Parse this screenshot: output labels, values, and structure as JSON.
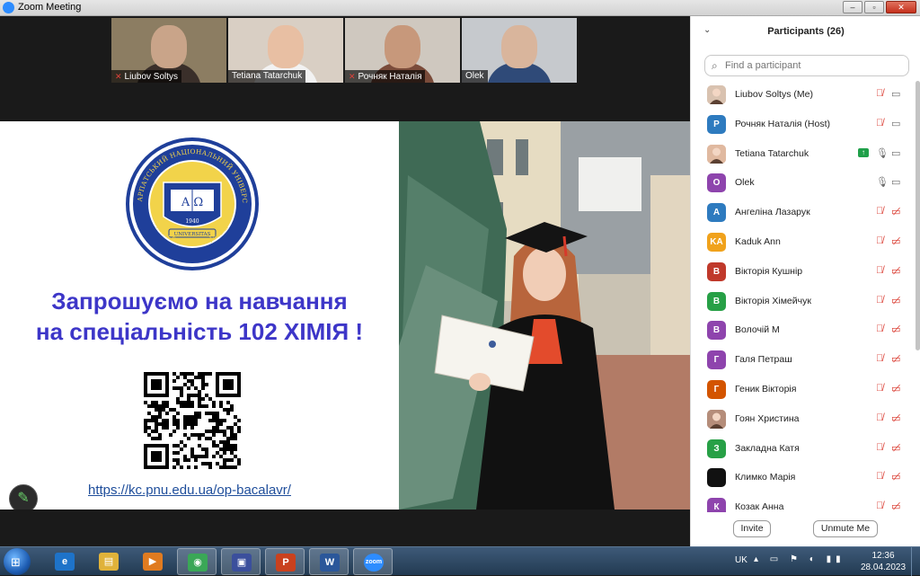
{
  "window": {
    "title": "Zoom Meeting",
    "controls": [
      "–",
      "▫",
      "✕"
    ]
  },
  "videos": [
    {
      "name": "Liubov Soltys",
      "muted": true,
      "bg": "#8c7d62",
      "face": "#c9a489",
      "body": "#3a2f2a"
    },
    {
      "name": "Tetiana Tatarchuk",
      "muted": false,
      "bg": "#d9cfc4",
      "face": "#e8bfa3",
      "body": "#f2f2f2"
    },
    {
      "name": "Рочняк Наталія",
      "muted": true,
      "bg": "#cfc8bf",
      "face": "#c7987b",
      "body": "#7a4b3a"
    },
    {
      "name": "Olek",
      "muted": false,
      "bg": "#c6c9cd",
      "face": "#d9b59c",
      "body": "#2f4a78"
    }
  ],
  "slide": {
    "headline_line1": "Запрошуємо на навчання",
    "headline_line2": "на спеціальність 102 ХІМІЯ !",
    "url": "https://kc.pnu.edu.ua/op-bacalavr/",
    "logo": {
      "ring_text": "ПРИКАРПАТСЬКИЙ НАЦІОНАЛЬНИЙ УНІВЕРСИТЕТ",
      "bottom_text": "імені Василя Стефаника",
      "book_text": "Α Ω",
      "year": "1940",
      "banner": "UNIVERSITAS"
    },
    "pen_icon": "pen-icon"
  },
  "participants": {
    "title": "Participants (26)",
    "search_placeholder": "Find a participant",
    "list": [
      {
        "name": "Liubov Soltys (Me)",
        "initials": "",
        "color": "#d9c2b0",
        "photo": true,
        "mic": "muted",
        "cam": "on",
        "share": false
      },
      {
        "name": "Рочняк Наталія (Host)",
        "initials": "Р",
        "color": "#2e7bbf",
        "photo": false,
        "mic": "muted",
        "cam": "on",
        "share": false
      },
      {
        "name": "Tetiana Tatarchuk",
        "initials": "",
        "color": "#e0b9a0",
        "photo": true,
        "mic": "on",
        "cam": "on",
        "share": true
      },
      {
        "name": "Olek",
        "initials": "O",
        "color": "#8e44ad",
        "photo": false,
        "mic": "on",
        "cam": "on",
        "share": false
      },
      {
        "name": " Ангеліна Лазарук",
        "initials": "А",
        "color": "#2e7bbf",
        "photo": false,
        "mic": "muted",
        "cam": "off",
        "share": false
      },
      {
        "name": "Kaduk Ann",
        "initials": "KA",
        "color": "#f0a21c",
        "photo": false,
        "mic": "muted",
        "cam": "off",
        "share": false
      },
      {
        "name": "Вікторія Кушнір",
        "initials": "В",
        "color": "#c0392b",
        "photo": false,
        "mic": "muted",
        "cam": "off",
        "share": false
      },
      {
        "name": "Вікторія Хімейчук",
        "initials": "В",
        "color": "#27a046",
        "photo": false,
        "mic": "muted",
        "cam": "off",
        "share": false
      },
      {
        "name": "Волочій М",
        "initials": "В",
        "color": "#8e44ad",
        "photo": false,
        "mic": "muted",
        "cam": "off",
        "share": false
      },
      {
        "name": "Галя Петраш",
        "initials": "Г",
        "color": "#8e44ad",
        "photo": false,
        "mic": "muted",
        "cam": "off",
        "share": false
      },
      {
        "name": "Геник Вікторія",
        "initials": "Г",
        "color": "#d35400",
        "photo": false,
        "mic": "muted",
        "cam": "off",
        "share": false
      },
      {
        "name": "Гоян Христина",
        "initials": "",
        "color": "#b58d7a",
        "photo": true,
        "mic": "muted",
        "cam": "off",
        "share": false
      },
      {
        "name": "Закладна Катя",
        "initials": "З",
        "color": "#27a046",
        "photo": false,
        "mic": "muted",
        "cam": "off",
        "share": false
      },
      {
        "name": "Климко Марія",
        "initials": "",
        "color": "#111111",
        "photo": false,
        "mic": "muted",
        "cam": "off",
        "share": false
      },
      {
        "name": "Козак Анна",
        "initials": "К",
        "color": "#8e44ad",
        "photo": false,
        "mic": "muted",
        "cam": "off",
        "share": false
      }
    ],
    "invite_label": "Invite",
    "unmute_label": "Unmute Me"
  },
  "taskbar": {
    "apps": [
      {
        "name": "internet-explorer-icon",
        "label": "e",
        "color": "#1e73c9",
        "active": false
      },
      {
        "name": "file-explorer-icon",
        "label": "▤",
        "color": "#e0b23a",
        "active": false
      },
      {
        "name": "media-player-icon",
        "label": "▶",
        "color": "#e07b20",
        "active": false
      },
      {
        "name": "chrome-icon",
        "label": "◉",
        "color": "#3aa757",
        "active": true
      },
      {
        "name": "save-disk-icon",
        "label": "▣",
        "color": "#3b4f9c",
        "active": true
      },
      {
        "name": "powerpoint-icon",
        "label": "P",
        "color": "#c9411e",
        "active": true
      },
      {
        "name": "word-icon",
        "label": "W",
        "color": "#2b579a",
        "active": true
      },
      {
        "name": "zoom-icon",
        "label": "zoom",
        "color": "#2d8cff",
        "active": true
      }
    ],
    "language": "UK",
    "time": "12:36",
    "date": "28.04.2023"
  }
}
